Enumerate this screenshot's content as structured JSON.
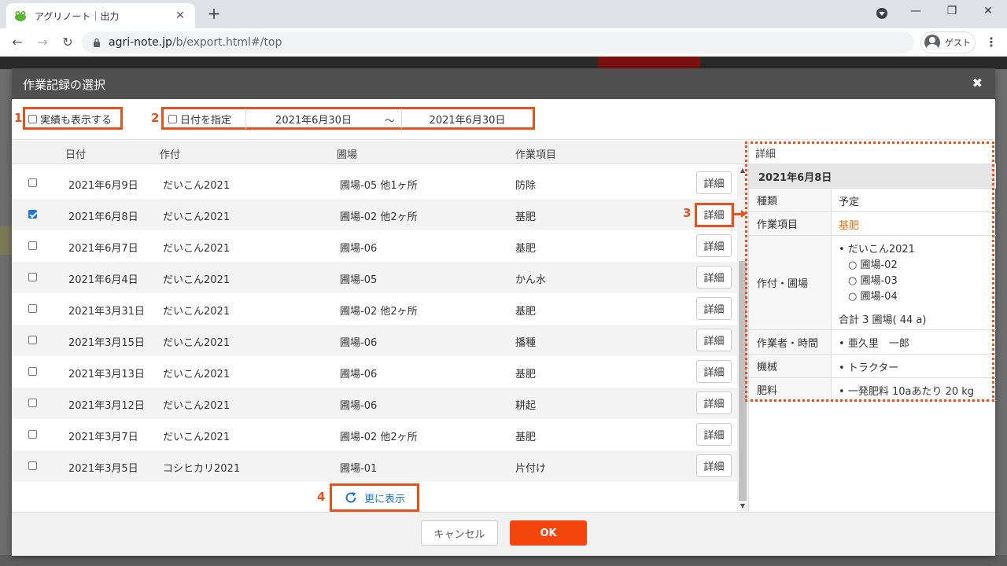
{
  "browser": {
    "tab_title": "アグリノート｜出力",
    "tab_close": "✕",
    "new_tab": "+",
    "url_host": "agri-note.jp",
    "url_path": "/b/export.html#/top",
    "guest_label": "ゲスト",
    "back": "←",
    "forward": "→",
    "reload": "↻",
    "minimize": "—",
    "restore": "❐",
    "close": "✕",
    "menu": "⋮"
  },
  "modal": {
    "title": "作業記録の選択",
    "close": "✖",
    "filters": {
      "show_results_label": "実績も表示する",
      "show_results_checked": false,
      "specify_date_label": "日付を指定",
      "specify_date_checked": false,
      "date_from": "2021年6月30日",
      "date_separator": "〜",
      "date_to": "2021年6月30日"
    },
    "table": {
      "headers": [
        "日付",
        "作付",
        "圃場",
        "作業項目"
      ],
      "detail_button_label": "詳細",
      "rows": [
        {
          "checked": false,
          "date": "2021年6月9日",
          "crop": "だいこん2021",
          "field": "圃場-05 他1ヶ所",
          "task": "防除"
        },
        {
          "checked": true,
          "date": "2021年6月8日",
          "crop": "だいこん2021",
          "field": "圃場-02 他2ヶ所",
          "task": "基肥"
        },
        {
          "checked": false,
          "date": "2021年6月7日",
          "crop": "だいこん2021",
          "field": "圃場-06",
          "task": "基肥"
        },
        {
          "checked": false,
          "date": "2021年6月4日",
          "crop": "だいこん2021",
          "field": "圃場-05",
          "task": "かん水"
        },
        {
          "checked": false,
          "date": "2021年3月31日",
          "crop": "だいこん2021",
          "field": "圃場-02 他2ヶ所",
          "task": "基肥"
        },
        {
          "checked": false,
          "date": "2021年3月15日",
          "crop": "だいこん2021",
          "field": "圃場-06",
          "task": "播種"
        },
        {
          "checked": false,
          "date": "2021年3月13日",
          "crop": "だいこん2021",
          "field": "圃場-06",
          "task": "基肥"
        },
        {
          "checked": false,
          "date": "2021年3月12日",
          "crop": "だいこん2021",
          "field": "圃場-06",
          "task": "耕起"
        },
        {
          "checked": false,
          "date": "2021年3月7日",
          "crop": "だいこん2021",
          "field": "圃場-02 他2ヶ所",
          "task": "基肥"
        },
        {
          "checked": false,
          "date": "2021年3月5日",
          "crop": "コシヒカリ2021",
          "field": "圃場-01",
          "task": "片付け"
        }
      ],
      "show_more_label": "更に表示"
    },
    "detail": {
      "caption": "詳細",
      "date": "2021年6月8日",
      "type_label": "種類",
      "type_value": "予定",
      "task_label": "作業項目",
      "task_value": "基肥",
      "crop_field_label": "作付・圃場",
      "crop_name": "だいこん2021",
      "fields": [
        "圃場-02",
        "圃場-03",
        "圃場-04"
      ],
      "field_total": "合計 3 圃場( 44 a)",
      "worker_label": "作業者・時間",
      "worker_value": "亜久里　一郎",
      "machine_label": "機械",
      "machine_value": "トラクター",
      "fertilizer_label": "肥料",
      "fertilizer_value": "一発肥料 10aあたり 20 kg"
    },
    "footer": {
      "cancel_label": "キャンセル",
      "ok_label": "OK"
    }
  },
  "annotations": [
    "1",
    "2",
    "3",
    "4"
  ],
  "colors": {
    "highlight": "#e8501e",
    "ok_button": "#f2460e",
    "link_blue": "#1e78c8",
    "modal_header": "#505050"
  }
}
